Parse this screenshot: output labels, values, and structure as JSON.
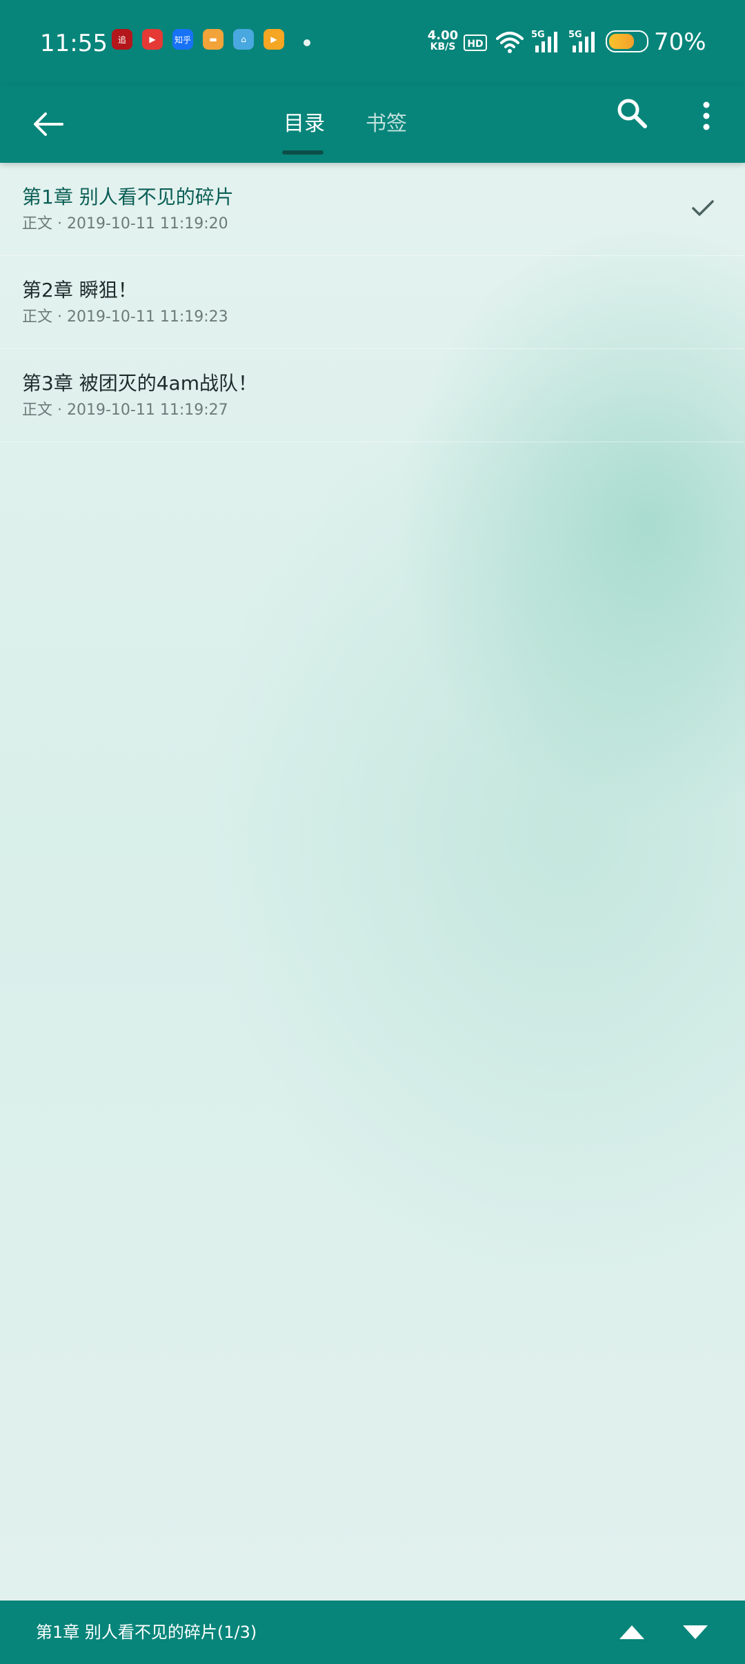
{
  "status_bar": {
    "time": "11:55",
    "net_speed_value": "4.00",
    "net_speed_unit": "KB/S",
    "hd_label": "HD",
    "signal1_label": "5G",
    "signal2_label": "5G",
    "battery": "70%",
    "battery_level": 0.7,
    "notification_icons": [
      {
        "name": "red-app-icon",
        "label": "追",
        "color": "#b3161b"
      },
      {
        "name": "video-app-icon",
        "label": "▶",
        "color": "#e53935"
      },
      {
        "name": "zhihu-app-icon",
        "label": "知乎",
        "color": "#1772f6"
      },
      {
        "name": "wallet-app-icon",
        "label": "▬",
        "color": "#f2a33a"
      },
      {
        "name": "home-app-icon",
        "label": "⌂",
        "color": "#4aa8e0"
      },
      {
        "name": "orange-video-app-icon",
        "label": "▶",
        "color": "#f5a623"
      }
    ]
  },
  "app_bar": {
    "tabs": [
      {
        "label": "目录",
        "active": true
      },
      {
        "label": "书签",
        "active": false
      }
    ]
  },
  "chapters": [
    {
      "title": "第1章 别人看不见的碎片",
      "meta": "正文 · 2019-10-11 11:19:20",
      "current": true
    },
    {
      "title": "第2章 瞬狙！",
      "meta": "正文 · 2019-10-11 11:19:23",
      "current": false
    },
    {
      "title": "第3章 被团灭的4am战队！",
      "meta": "正文 · 2019-10-11 11:19:27",
      "current": false
    }
  ],
  "bottom_bar": {
    "current_chapter": "第1章 别人看不见的碎片(1/3)"
  },
  "colors": {
    "primary": "#08857a",
    "indicator": "#0c4f48"
  }
}
